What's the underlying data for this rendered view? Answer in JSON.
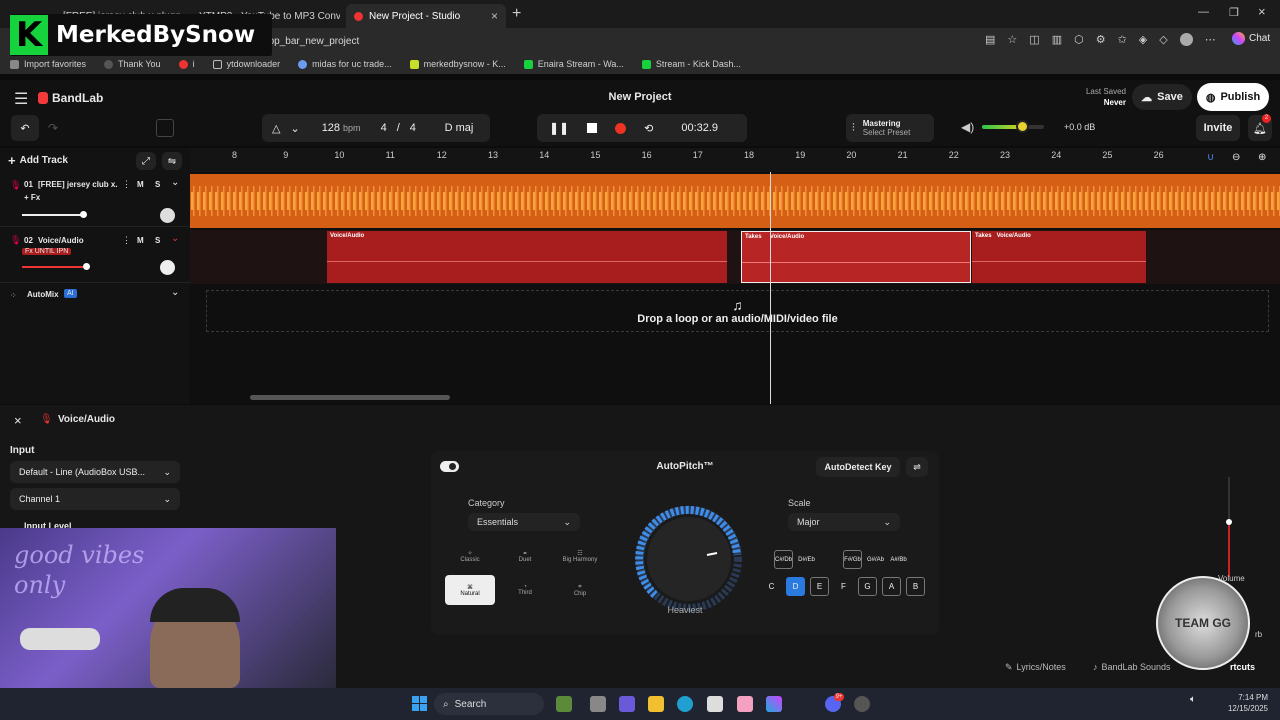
{
  "browser": {
    "tabs": [
      {
        "title": "[FREE] jersey club x pluggnb ty"
      },
      {
        "title": "YTMP3 - YouTube to MP3 Convert"
      },
      {
        "title": "New Project - Studio"
      }
    ],
    "url": "=top_bar_new_project",
    "favorites": [
      "Import favorites",
      "Thank You",
      "i",
      "ytdownloader",
      "midas for uc trade...",
      "merkedbysnow - K...",
      "Enaira Stream - Wa...",
      "Stream - Kick Dash..."
    ],
    "chat_label": "Chat"
  },
  "overlay": {
    "letter": "K",
    "name": "MerkedBySnow"
  },
  "app": {
    "brand": "BandLab",
    "project_title": "New Project",
    "last_saved_label": "Last Saved",
    "last_saved_value": "Never",
    "save_label": "Save",
    "publish_label": "Publish",
    "tempo": "128",
    "tempo_unit": "bpm",
    "time_sig_num": "4",
    "time_sig_sep": "/",
    "time_sig_den": "4",
    "key": "D maj",
    "time": "00:32.9",
    "mastering_label": "Mastering",
    "mastering_preset": "Select Preset",
    "volume_db": "+0.0 dB",
    "invite_label": "Invite",
    "notification_count": "2",
    "add_track_label": "Add Track",
    "ruler_ticks": [
      "8",
      "9",
      "10",
      "11",
      "12",
      "13",
      "14",
      "15",
      "16",
      "17",
      "18",
      "19",
      "20",
      "21",
      "22",
      "23",
      "24",
      "25",
      "26"
    ]
  },
  "tracks": [
    {
      "number": "01",
      "name": "[FREE] jersey club x...",
      "fx": "+ Fx",
      "mute": "M",
      "solo": "S",
      "pan_r": "R",
      "pan_l": "L",
      "color": "#e06a17"
    },
    {
      "number": "02",
      "name": "Voice/Audio",
      "fx": "Fx UNTIL IPN",
      "mute": "M",
      "solo": "S",
      "pan_r": "R",
      "pan_l": "L",
      "color": "#a81d1d"
    }
  ],
  "clips": [
    {
      "label": "Voice/Audio"
    },
    {
      "label": "Takes",
      "label2": "Voice/Audio"
    },
    {
      "label": "Takes",
      "label2": "Voice/Audio"
    }
  ],
  "automix": {
    "label": "AutoMix",
    "badge": "AI"
  },
  "dropzone": {
    "text": "Drop a loop or an audio/MIDI/video file"
  },
  "panel": {
    "track_name": "Voice/Audio",
    "input_label": "Input",
    "input_device": "Default - Line (AudioBox USB...",
    "channel": "Channel 1",
    "input_level_label": "Input Level",
    "autopitch_title": "AutoPitch™",
    "autodetect_label": "AutoDetect Key",
    "category_label": "Category",
    "category_value": "Essentials",
    "categories": [
      "Classic",
      "Duet",
      "Big Harmony",
      "Natural",
      "Third",
      "Chip"
    ],
    "selected_category": "Natural",
    "knob_label": "Heaviest",
    "scale_label": "Scale",
    "scale_value": "Major",
    "sharps": [
      "C#/Db",
      "D#/Eb",
      "F#/Gb",
      "G#/Ab",
      "A#/Bb"
    ],
    "keys": [
      "C",
      "D",
      "E",
      "F",
      "G",
      "A",
      "B"
    ],
    "selected_key": "D",
    "volume_label": "Volume",
    "lyrics_label": "Lyrics/Notes",
    "sounds_label": "BandLab Sounds",
    "shortcuts_label": "rtcuts",
    "reverb_label": "rb"
  },
  "webcam_text": "good vibes only",
  "badge_text": "TEAM GG",
  "taskbar": {
    "search_label": "Search",
    "time": "7:14 PM",
    "date": "12/15/2025",
    "notif": "9+"
  }
}
